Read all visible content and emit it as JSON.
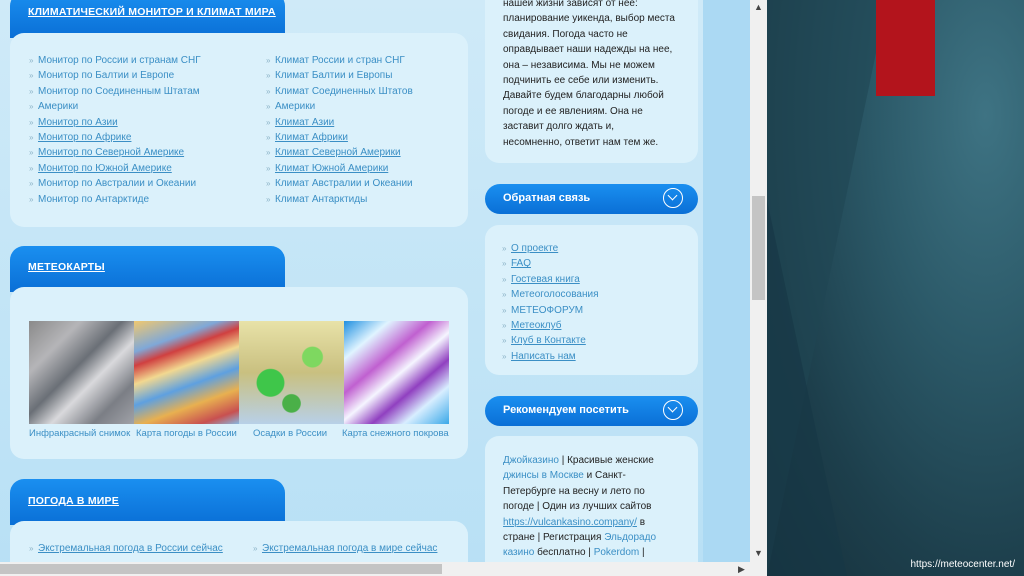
{
  "colors": {
    "accent": "#0a6fd6",
    "link": "#3b8fc5",
    "panel": "#dbf1fb",
    "slide_red": "#b3141c"
  },
  "left": {
    "climate_tab": {
      "label_a": "КЛИМАТИЧЕСКИЙ МОНИТОР",
      "label_and": "И",
      "label_b": "КЛИМАТ МИРА"
    },
    "monitors": [
      "Монитор по России и странам СНГ",
      "Монитор по Балтии и Европе",
      "Монитор по Соединенным Штатам",
      "Америки",
      "Монитор по Азии",
      "Монитор по Африке",
      "Монитор по Северной Америке",
      "Монитор по Южной Америке",
      "Монитор по Австралии и Океании",
      "Монитор по Антарктиде"
    ],
    "climates": [
      "Климат России и стран СНГ",
      "Климат Балтии и Европы",
      "Климат Соединенных Штатов",
      "Америки",
      "Климат Азии",
      "Климат Африки",
      "Климат Северной Америки",
      "Климат Южной Америки",
      "Климат Австралии и Океании",
      "Климат Антарктиды"
    ],
    "meteo_tab": {
      "label": "МЕТЕОКАРТЫ"
    },
    "map_captions": [
      "Инфракрасный снимок",
      "Карта погоды в России",
      "Осадки в России",
      "Карта снежного покрова"
    ],
    "weather_tab": {
      "label": "ПОГОДА В МИРЕ"
    },
    "weather_links": [
      "Экстремальная погода в России сейчас",
      "Экстремальная погода в мире сейчас"
    ]
  },
  "right": {
    "intro_lines": [
      "нашей жизни зависят от нее:",
      "планирование уикенда, выбор места",
      "свидания. Погода часто не",
      "оправдывает наши надежды на нее,",
      "она – независима. Мы не можем",
      "подчинить ее себе или изменить.",
      "Давайте будем благодарны любой",
      "погоде и ее явлениям. Она не",
      "заставит долго ждать и,",
      "несомненно, ответит нам тем же."
    ],
    "feedback_tab": {
      "label": "Обратная связь"
    },
    "feedback_links": [
      "О проекте",
      "FAQ",
      "Гостевая книга",
      "Метеоголосования",
      "МЕТЕОФОРУМ",
      "Метеоклуб",
      "Клуб в Контакте",
      "Написать нам"
    ],
    "recommend_tab": {
      "label": "Рекомендуем посетить"
    },
    "recommend": {
      "l1a": "Джойказино",
      "l1b": "|",
      "l1c": "Красивые женские",
      "l2a": "джинсы в Москве",
      "l2b": "и Санкт-",
      "l3": "Петербурге на весну и лето по",
      "l4": "погоде | Один из лучших сайтов",
      "l5a": "https://vulcankasino.company/",
      "l5b": "в",
      "l6a": "стране | Регистрация",
      "l6b": "Эльдорадо",
      "l7a": "казино",
      "l7b": "бесплатно |",
      "l7c": "Pokerdom",
      "l7d": "|"
    }
  },
  "scrollbar": {
    "up": "▲",
    "down": "▼",
    "left": "◀",
    "right": "▶"
  },
  "slide": {
    "url": "https://meteocenter.net/"
  }
}
